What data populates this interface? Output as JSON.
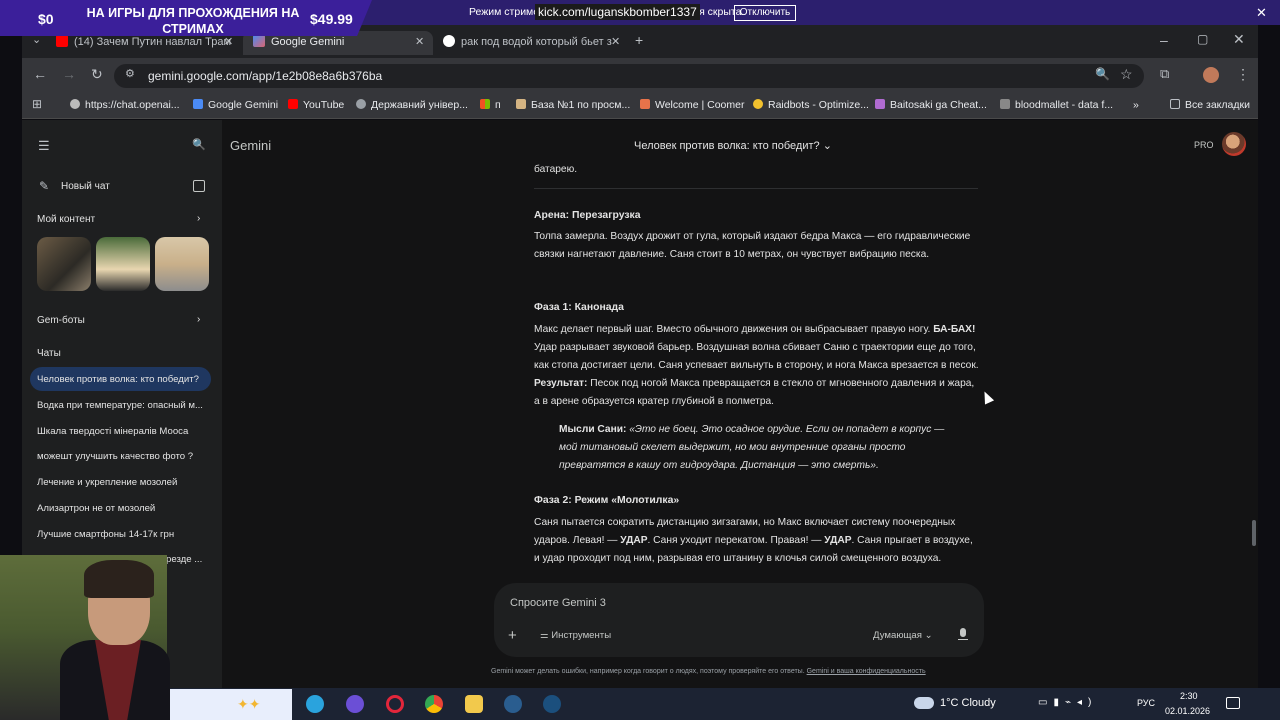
{
  "promo": {
    "price_old": "$0",
    "title": "НА ИГРЫ ДЛЯ ПРОХОЖДЕНИЯ НА СТРИМАХ",
    "price_new": "$49.99"
  },
  "stream_notice": {
    "text_before": "Режим стример",
    "url": "kick.com/luganskbomber1337",
    "text_after": "ля скрыта.",
    "button": "Отключить"
  },
  "tabs": [
    {
      "label": "(14) Зачем Путин навлал Трам"
    },
    {
      "label": "Google Gemini"
    },
    {
      "label": "рак под водой который бьет з"
    }
  ],
  "address": {
    "url": "gemini.google.com/app/1e2b08e8a6b376ba"
  },
  "bookmarks": [
    {
      "label": "https://chat.openai..."
    },
    {
      "label": "Google Gemini"
    },
    {
      "label": "YouTube"
    },
    {
      "label": "Державний універ..."
    },
    {
      "label": "п"
    },
    {
      "label": "База №1 по просм..."
    },
    {
      "label": "Welcome | Coomer"
    },
    {
      "label": "Raidbots - Optimize..."
    },
    {
      "label": "Baitosaki ga Cheat..."
    },
    {
      "label": "bloodmallet - data f..."
    }
  ],
  "all_bookmarks": "Все закладки",
  "gemini": {
    "brand": "Gemini",
    "chat_title": "Человек против волка: кто победит?",
    "pro": "PRO",
    "new_chat": "Новый чат",
    "my_content": "Мой контент",
    "gems": "Gem-боты",
    "chats_heading": "Чаты",
    "chats": [
      "Человек против волка: кто победит?",
      "Водка при температуре: опасный м...",
      "Шкала твердості мінералів Мооса",
      "можешт улучшить качество фото ?",
      "Лечение и укрепление мозолей",
      "Ализартрон не от мозолей",
      "Лучшие смартфоны 14-17к грн",
      "резде ..."
    ]
  },
  "content": {
    "prev_tail": "батарею.",
    "h1": "Арена: Перезагрузка",
    "p1": "Толпа замерла. Воздух дрожит от гула, который издают бедра Макса — его гидравлические связки нагнетают давление. Саня стоит в 10 метрах, он чувствует вибрацию песка.",
    "h2": "Фаза 1: Канонада",
    "p2_a": "Макс делает первый шаг. Вместо обычного движения он выбрасывает правую ногу. ",
    "p2_bold1": "БА-БАХ!",
    "p2_b": " Удар разрывает звуковой барьер. Воздушная волна сбивает Саню с траектории еще до того, как стопа достигает цели. Саня успевает вильнуть в сторону, и нога Макса врезается в песок. ",
    "p2_bold2": "Результат:",
    "p2_c": " Песок под ногой Макса превращается в стекло от мгновенного давления и жара, а в арене образуется кратер глубиной в полметра.",
    "q_label": "Мысли Сани:",
    "q_text": " «Это не боец. Это осадное орудие. Если он попадет в корпус — мой титановый скелет выдержит, но мои внутренние органы просто превратятся в кашу от гидроудара. Дистанция — это смерть».",
    "h3": "Фаза 2: Режим «Молотилка»",
    "p3_a": "Саня пытается сократить дистанцию зигзагами, но Макс включает систему поочередных ударов. Левая! — ",
    "p3_bold1": "УДАР",
    "p3_b": ". Саня уходит перекатом. Правая! — ",
    "p3_bold2": "УДАР",
    "p3_c": ". Саня прыгает в воздухе, и удар проходит под ним, разрывая его штанину в клочья силой смещенного воздуха."
  },
  "input": {
    "placeholder": "Спросите Gemini 3",
    "tools": "Инструменты",
    "mode": "Думающая",
    "disclaimer": "Gemini может делать ошибки, например когда говорит о людях, поэтому проверяйте его ответы. ",
    "disclaimer_link": "Gemini и ваша конфиденциальность"
  },
  "taskbar": {
    "weather": "1°C  Cloudy",
    "lang": "РУС",
    "time": "2:30",
    "date": "02.01.2026"
  },
  "colors": {
    "accent_active_chat": "#1f3760",
    "promo_bg": "#3b1f9a",
    "app_bg": "#131314",
    "sidebar_bg": "#1e1f20"
  }
}
